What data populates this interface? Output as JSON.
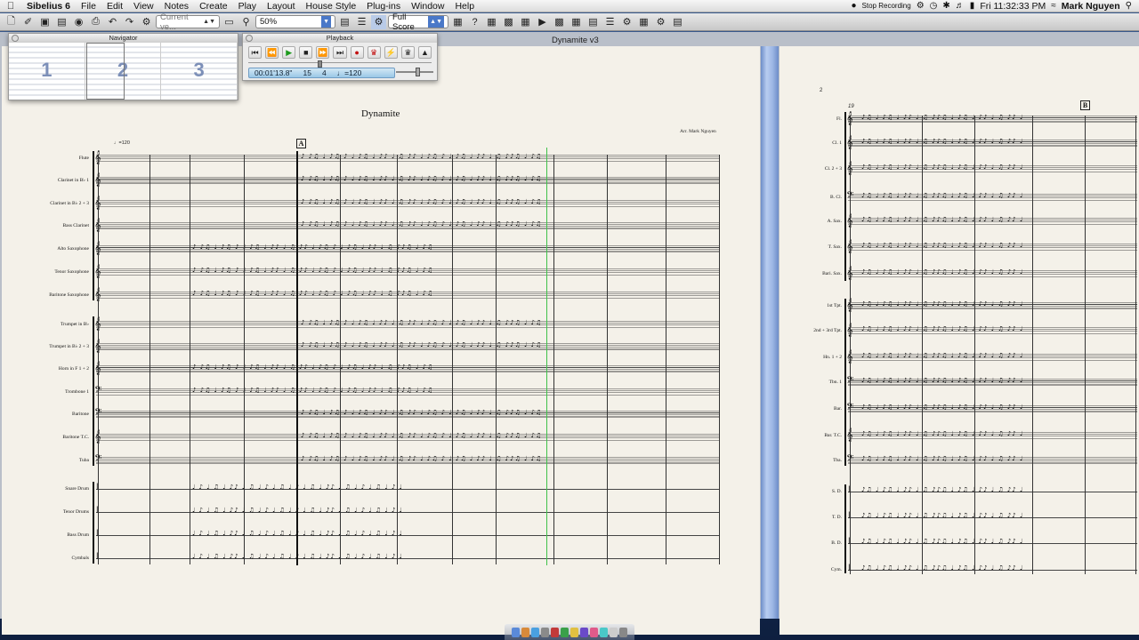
{
  "menubar": {
    "app_name": "Sibelius 6",
    "items": [
      "File",
      "Edit",
      "View",
      "Notes",
      "Create",
      "Play",
      "Layout",
      "House Style",
      "Plug-ins",
      "Window",
      "Help"
    ],
    "stop_recording": "Stop Recording",
    "clock": "Fri 11:32:33 PM",
    "user": "Mark Nguyen"
  },
  "toolbar": {
    "version_select": "Current ve...",
    "zoom": "50%",
    "score_select": "Full Score"
  },
  "window": {
    "title": "Dynamite v3"
  },
  "navigator": {
    "title": "Navigator",
    "pages": [
      "1",
      "2",
      "3"
    ]
  },
  "playback": {
    "title": "Playback",
    "time": "00:01'13.8\"",
    "bar": "15",
    "beat": "4",
    "tempo": "♩=120"
  },
  "score": {
    "title": "Dynamite",
    "arranger": "Arr. Mark Nguyen",
    "tempo_mark": "♩=120",
    "rehearsal_a": "A",
    "rehearsal_b": "B",
    "page2_number": "2",
    "page2_bar": "19",
    "page1_instruments": [
      "Flute",
      "Clarinet in B♭ 1",
      "Clarinet in B♭ 2 + 3",
      "Bass Clarinet",
      "Alto Saxophone",
      "Tenor Saxophone",
      "Baritone Saxophone",
      "Trumpet in B♭",
      "Trumpet in B♭ 2 + 3",
      "Horn in F 1 + 2",
      "Trombone 1",
      "Baritone",
      "Baritone T.C.",
      "Tuba",
      "Snare Drum",
      "Tenor Drums",
      "Bass Drum",
      "Cymbals"
    ],
    "page2_instruments": [
      "Fl.",
      "Cl. 1",
      "Cl. 2 + 3",
      "B. Cl.",
      "A. Sax.",
      "T. Sax.",
      "Bari. Sax.",
      "1st Tpt.",
      "2nd + 3rd Tpt.",
      "Hn. 1 + 2",
      "Tbn. 1",
      "Bar.",
      "Bar. T.C.",
      "Tba.",
      "S. D.",
      "T. D.",
      "B. D.",
      "Cym."
    ]
  },
  "colors": {
    "playback_line": "#3fc24a",
    "page_divider": "#9cb6e4",
    "paper": "#f4f1e9"
  }
}
